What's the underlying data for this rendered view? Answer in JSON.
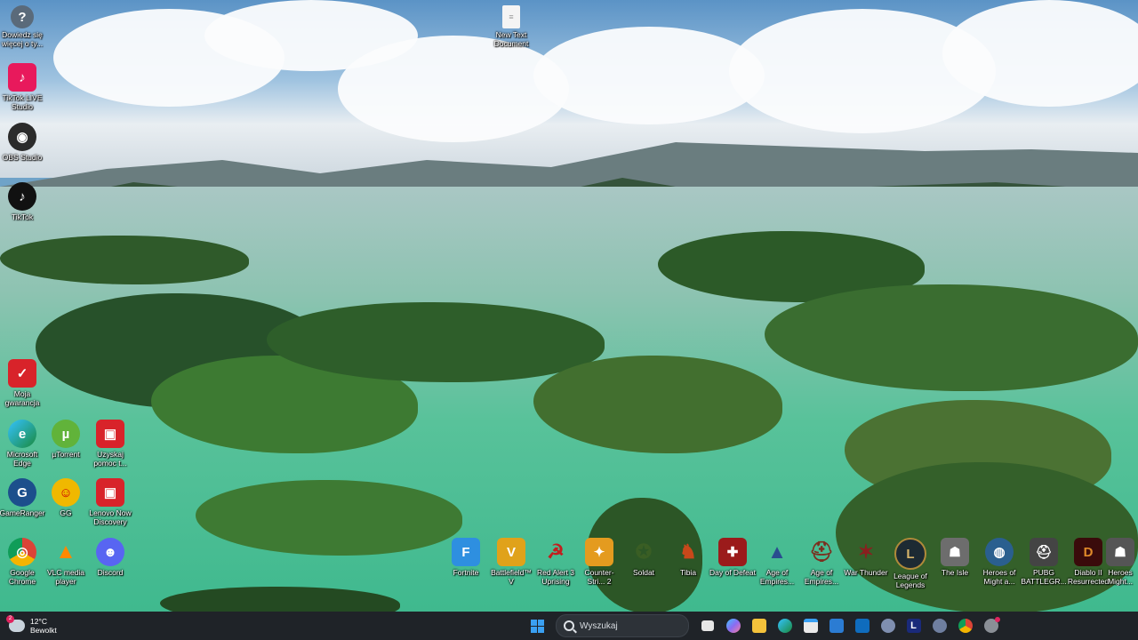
{
  "desktop": {
    "left_column": [
      {
        "id": "get-help",
        "label": "Dowiedz się więcej o ty...",
        "icon": "help-icon",
        "color": "#5a6a7a",
        "glyph": "?"
      },
      {
        "id": "tiktok-live",
        "label": "TikTok LIVE Studio",
        "icon": "tiktok-live-icon",
        "color": "#e8195c",
        "glyph": "♪"
      },
      {
        "id": "obs",
        "label": "OBS Studio",
        "icon": "obs-icon",
        "color": "#2b2b2b",
        "glyph": "◉"
      },
      {
        "id": "tiktok",
        "label": "TikTok",
        "icon": "tiktok-icon",
        "color": "#111111",
        "glyph": "♪"
      },
      {
        "id": "moja-gwarancja",
        "label": "Moja gwarancja",
        "icon": "warranty-icon",
        "color": "#d8232a",
        "glyph": "✓"
      }
    ],
    "grid": [
      {
        "id": "edge",
        "label": "Microsoft Edge",
        "icon": "edge-icon",
        "color": "#1b8ad6",
        "glyph": "e"
      },
      {
        "id": "utorrent",
        "label": "µTorrent",
        "icon": "utorrent-icon",
        "color": "#61b33a",
        "glyph": "µ"
      },
      {
        "id": "uzyskaj",
        "label": "Uzyskaj pomoc t...",
        "icon": "support-icon",
        "color": "#d8232a",
        "glyph": "▣"
      },
      {
        "id": "gameranger",
        "label": "GameRanger",
        "icon": "gameranger-icon",
        "color": "#1c4f8c",
        "glyph": "G"
      },
      {
        "id": "gg",
        "label": "GG",
        "icon": "gg-icon",
        "color": "#f0b800",
        "glyph": "☺"
      },
      {
        "id": "lenovo-now",
        "label": "Lenovo Now Discovery",
        "icon": "lenovo-now-icon",
        "color": "#d8232a",
        "glyph": "▣"
      },
      {
        "id": "chrome",
        "label": "Google Chrome",
        "icon": "chrome-icon",
        "color": "#dd4b39",
        "glyph": "◎"
      },
      {
        "id": "vlc",
        "label": "VLC media player",
        "icon": "vlc-icon",
        "color": "#ff8800",
        "glyph": "▲"
      },
      {
        "id": "discord",
        "label": "Discord",
        "icon": "discord-icon",
        "color": "#5865f2",
        "glyph": "☻"
      }
    ],
    "top_file": {
      "label": "New Text Document",
      "icon": "text-document-icon"
    },
    "games": [
      {
        "id": "fortnite",
        "label": "Fortnite",
        "icon": "fortnite-icon",
        "color": "#2e8fe0",
        "glyph": "F"
      },
      {
        "id": "bf5",
        "label": "Battlefield™ V",
        "icon": "battlefield-icon",
        "color": "#e0a21a",
        "glyph": "V"
      },
      {
        "id": "ra3",
        "label": "Red Alert 3 Uprising",
        "icon": "red-alert-icon",
        "color": "#b52020",
        "glyph": "☭"
      },
      {
        "id": "cs",
        "label": "Counter-Stri... 2",
        "icon": "counter-strike-icon",
        "color": "#e49b1f",
        "glyph": "✦"
      },
      {
        "id": "soldat",
        "label": "Soldat",
        "icon": "soldat-icon",
        "color": "#4c6a2c",
        "glyph": "✪"
      },
      {
        "id": "tibia",
        "label": "Tibia",
        "icon": "tibia-icon",
        "color": "#b34a1a",
        "glyph": "♞"
      },
      {
        "id": "dod",
        "label": "Day of Defeat",
        "icon": "day-of-defeat-icon",
        "color": "#9b1b1b",
        "glyph": "✚"
      },
      {
        "id": "aoe1",
        "label": "Age of Empires...",
        "icon": "age-of-empires-icon",
        "color": "#2a4d8f",
        "glyph": "▲"
      },
      {
        "id": "aoe2",
        "label": "Age of Empires...",
        "icon": "age-of-empires-icon-2",
        "color": "#7a2f1f",
        "glyph": "⛑"
      },
      {
        "id": "wt",
        "label": "War Thunder",
        "icon": "war-thunder-icon",
        "color": "#7a1f1f",
        "glyph": "✶"
      },
      {
        "id": "lol",
        "label": "League of Legends",
        "icon": "league-icon",
        "color": "#b08a3a",
        "glyph": "L"
      },
      {
        "id": "isle",
        "label": "The Isle",
        "icon": "the-isle-icon",
        "color": "#6d6d6d",
        "glyph": "☗"
      },
      {
        "id": "homm",
        "label": "Heroes of Might a...",
        "icon": "heroes-icon",
        "color": "#2a5f8f",
        "glyph": "◍"
      },
      {
        "id": "pubg",
        "label": "PUBG BATTLEGR...",
        "icon": "pubg-icon",
        "color": "#444444",
        "glyph": "⛑"
      },
      {
        "id": "d2",
        "label": "Diablo II Resurrected",
        "icon": "diablo-icon",
        "color": "#6b1010",
        "glyph": "D"
      },
      {
        "id": "heroes2",
        "label": "Heroes Might...",
        "icon": "heroes-icon-2",
        "color": "#555555",
        "glyph": "☗"
      }
    ]
  },
  "taskbar": {
    "weather": {
      "temp": "12°C",
      "condition": "Bewolkt",
      "badge": "2"
    },
    "search_placeholder": "Wyszukaj",
    "apps": [
      {
        "id": "task-view",
        "icon": "task-view-icon",
        "color": "#e6e6e6"
      },
      {
        "id": "copilot",
        "icon": "copilot-icon",
        "color": "#8a6cf2"
      },
      {
        "id": "explorer",
        "icon": "file-explorer-icon",
        "color": "#f4c23b"
      },
      {
        "id": "edge",
        "icon": "edge-icon",
        "color": "#1b9de2"
      },
      {
        "id": "store",
        "icon": "store-icon",
        "color": "#eaeaea"
      },
      {
        "id": "word",
        "icon": "editor-icon",
        "color": "#2b7cd3"
      },
      {
        "id": "outlook",
        "icon": "outlook-icon",
        "color": "#0f6cbd"
      },
      {
        "id": "app1",
        "icon": "app-circle-icon",
        "color": "#7f8fb0"
      },
      {
        "id": "lenovo",
        "icon": "lenovo-l-icon",
        "color": "#1a2a7a"
      },
      {
        "id": "app2",
        "icon": "app-circle-icon-2",
        "color": "#6f7fa0"
      },
      {
        "id": "chrome",
        "icon": "chrome-icon",
        "color": "#dd4b39"
      },
      {
        "id": "app3",
        "icon": "settings-badge-icon",
        "color": "#8a8f96"
      }
    ]
  }
}
